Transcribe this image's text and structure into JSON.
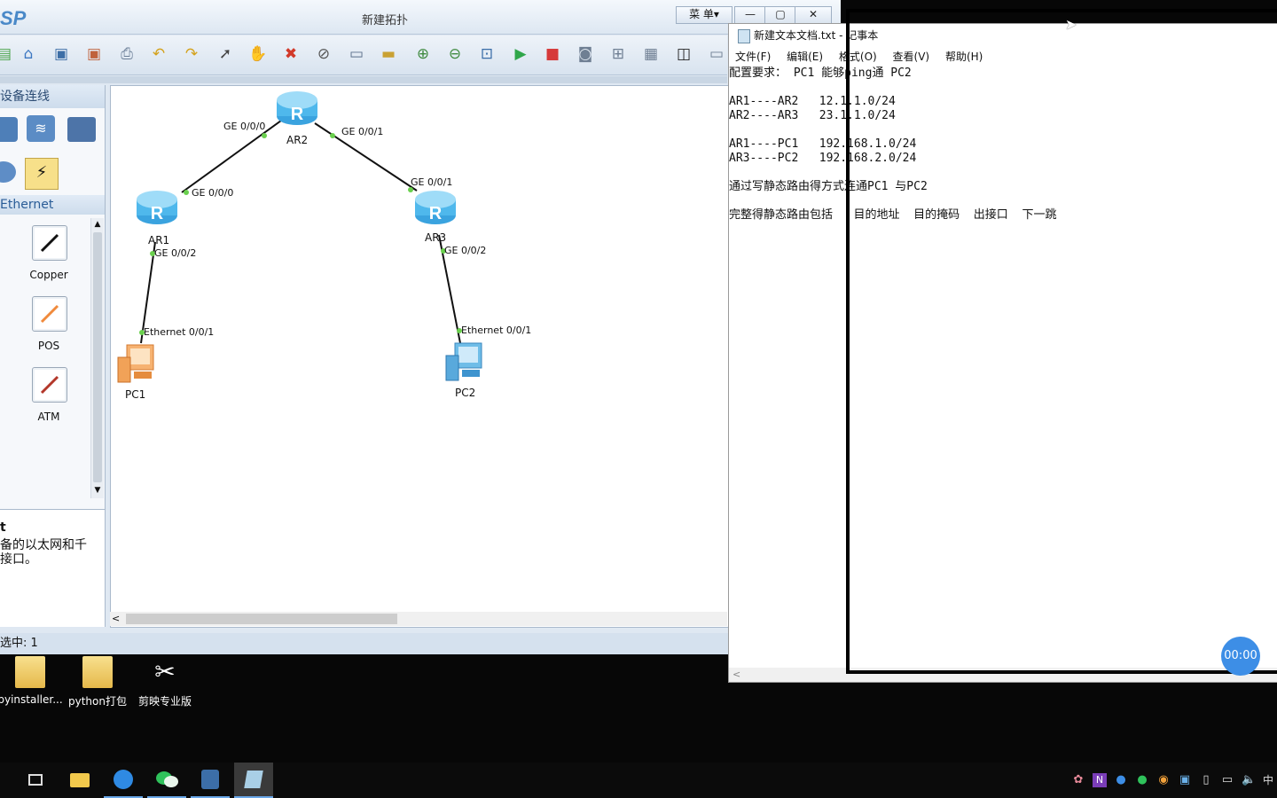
{
  "ensp": {
    "logo": "SP",
    "title": "新建拓扑",
    "menu_button": "菜 单▾",
    "window_buttons": [
      "—",
      "▢",
      "✕"
    ],
    "left_panel": {
      "header": "设备连线",
      "category": "Ethernet",
      "cables": [
        {
          "label": "Copper",
          "color": "#111111"
        },
        {
          "label": "POS",
          "color": "#f08a3c"
        },
        {
          "label": "ATM",
          "color": "#b3372a"
        }
      ],
      "desc_title": "t",
      "desc_line1": "备的以太网和千",
      "desc_line2": "接口。"
    },
    "status": "选中: 1",
    "topology": {
      "devices": {
        "ar1": "AR1",
        "ar2": "AR2",
        "ar3": "AR3",
        "pc1": "PC1",
        "pc2": "PC2"
      },
      "ports": {
        "ar2_left": "GE 0/0/0",
        "ar2_right": "GE 0/0/1",
        "ar1_top": "GE 0/0/0",
        "ar3_top": "GE 0/0/1",
        "ar1_bottom": "GE 0/0/2",
        "ar3_bottom": "GE 0/0/2",
        "pc1": "Ethernet 0/0/1",
        "pc2": "Ethernet 0/0/1"
      }
    }
  },
  "notepad": {
    "title": "新建文本文档.txt - 记事本",
    "menu": [
      "文件(F)",
      "编辑(E)",
      "格式(O)",
      "查看(V)",
      "帮助(H)"
    ],
    "content": "配置要求： PC1 能够ping通 PC2\n\nAR1----AR2   12.1.1.0/24\nAR2----AR3   23.1.1.0/24\n\nAR1----PC1   192.168.1.0/24\nAR3----PC2   192.168.2.0/24\n\n通过写静态路由得方式连通PC1 与PC2\n\n完整得静态路由包括   目的地址  目的掩码  出接口  下一跳"
  },
  "timer": "00:00",
  "desktop_icons": [
    "pyinstaller...",
    "python打包",
    "剪映专业版"
  ],
  "taskbar": {
    "items": [
      "task-view",
      "file-explorer",
      "browser",
      "wechat",
      "ensp-app",
      "notepad"
    ],
    "ime": "中"
  }
}
